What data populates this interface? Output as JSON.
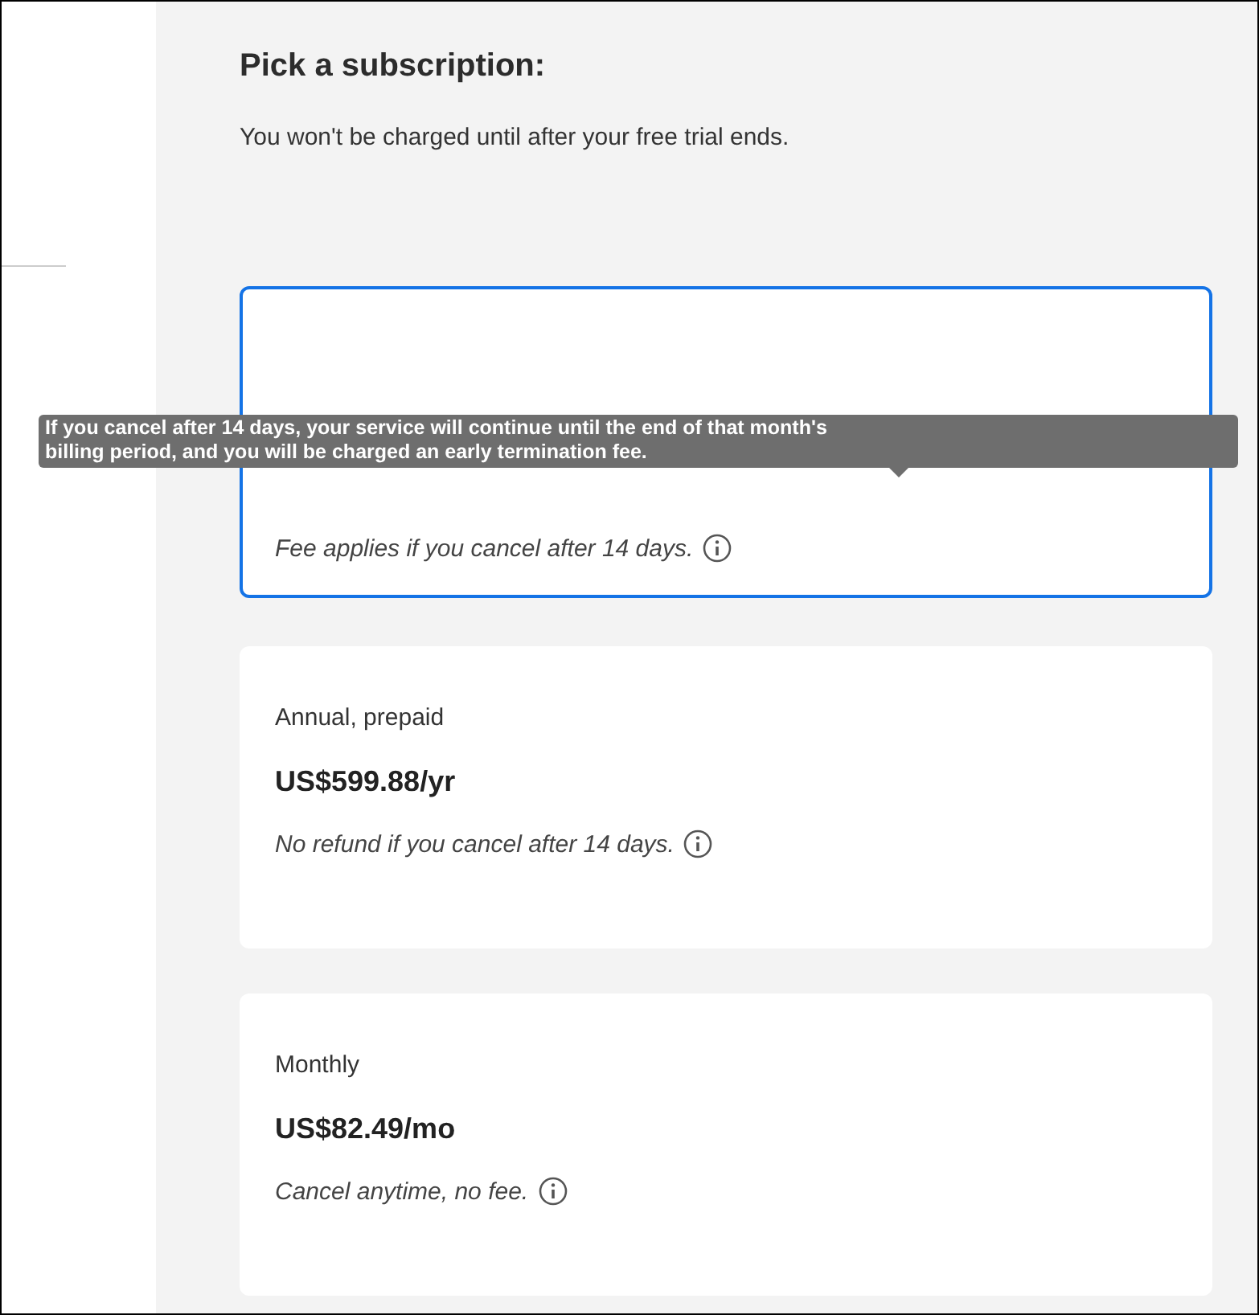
{
  "heading": "Pick a subscription:",
  "subheading": "You won't be charged until after your free trial ends.",
  "plans": [
    {
      "selected": true,
      "note": "Fee applies if you cancel after 14 days."
    },
    {
      "selected": false,
      "name": "Annual, prepaid",
      "price": "US$599.88/yr",
      "note": "No refund if you cancel after 14 days."
    },
    {
      "selected": false,
      "name": "Monthly",
      "price": "US$82.49/mo",
      "note": "Cancel anytime, no fee."
    }
  ],
  "tooltip": {
    "lines": [
      "If you cancel after 14 days, your service will continue until the end of that month's",
      "billing period, and you will be charged an early termination fee."
    ]
  }
}
